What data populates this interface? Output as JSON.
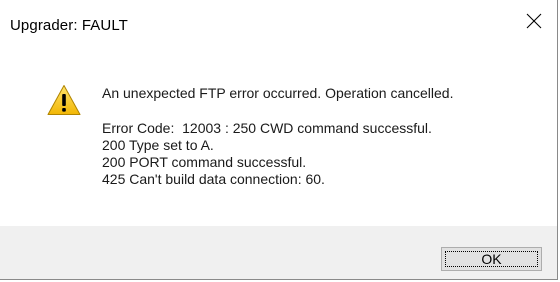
{
  "window": {
    "title": "Upgrader: FAULT"
  },
  "icons": {
    "close": "close-icon",
    "warning": "warning-icon",
    "warning_fill": "#f5c211",
    "warning_mark": "#000000"
  },
  "message": {
    "headline": "An unexpected FTP error occurred.  Operation cancelled.",
    "details": [
      "Error Code:  12003 : 250 CWD command successful.",
      "200 Type set to A.",
      "200 PORT command successful.",
      "425 Can't build data connection: 60."
    ]
  },
  "buttons": {
    "ok_label": "OK"
  },
  "colors": {
    "footer_background": "#f0f0f0",
    "button_background": "#e1e1e1"
  }
}
